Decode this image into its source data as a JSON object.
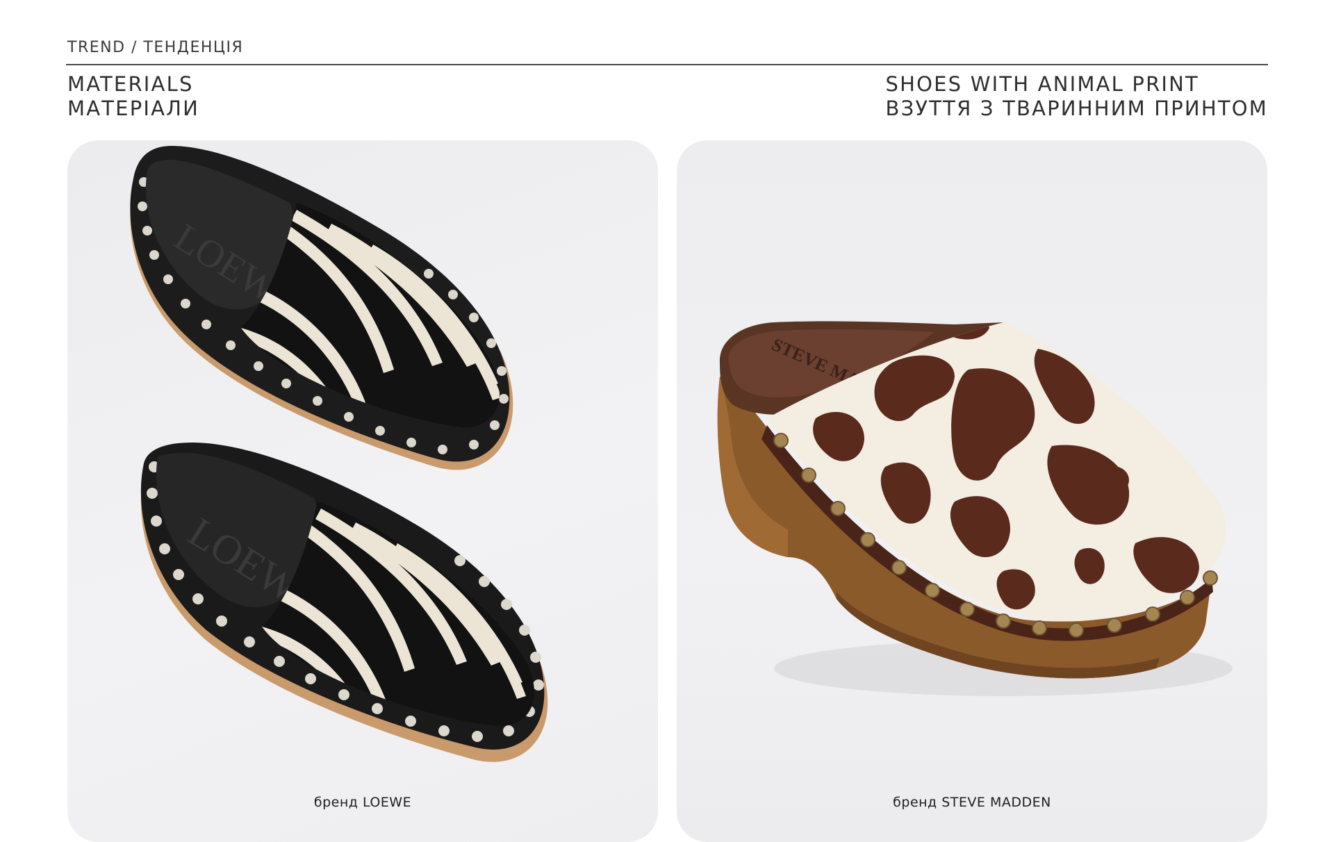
{
  "header": {
    "breadcrumb": "TREND / ТЕНДЕНЦІЯ",
    "category_en": "MATERIALS",
    "category_ua": "МАТЕРІАЛИ",
    "topic_en": "SHOES WITH ANIMAL PRINT",
    "topic_ua": "ВЗУТТЯ З ТВАРИННИМ ПРИНТОМ"
  },
  "products": [
    {
      "caption": "бренд LOEWE",
      "insole_logo": "LOEWE",
      "print": "zebra"
    },
    {
      "caption": "бренд STEVE MADDEN",
      "insole_logo": "STEVE MADDEN",
      "print": "cow"
    }
  ]
}
